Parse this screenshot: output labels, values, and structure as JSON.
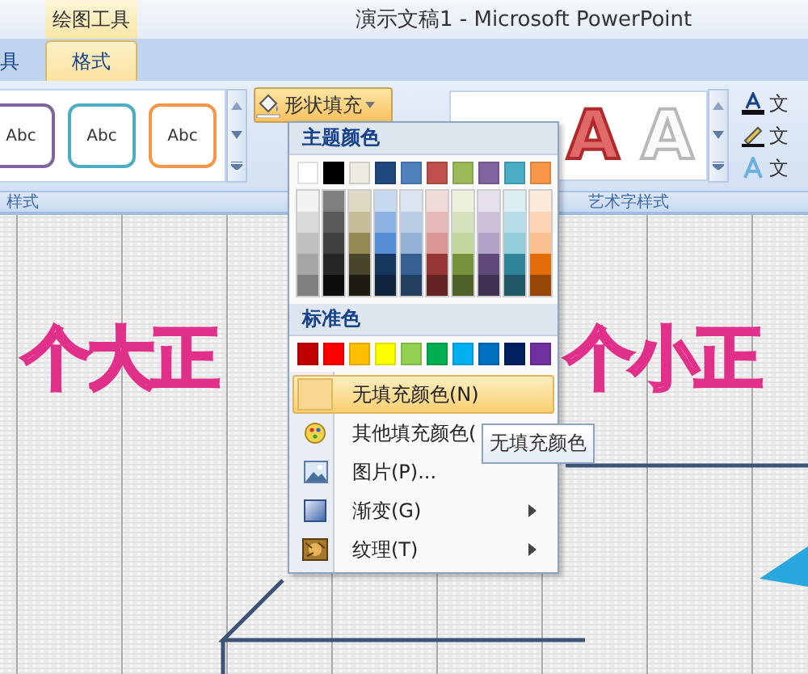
{
  "contextual_tab_group": "绘图工具",
  "window": {
    "title": "演示文稿1 - Microsoft PowerPoint"
  },
  "tabs": [
    {
      "label": "具",
      "selected": false
    },
    {
      "label": "格式",
      "selected": true
    }
  ],
  "shape_styles": {
    "group_label": "样式",
    "items": [
      {
        "label": "Abc",
        "color": "#8064a2"
      },
      {
        "label": "Abc",
        "color": "#4bacc6"
      },
      {
        "label": "Abc",
        "color": "#f79646"
      }
    ]
  },
  "shape_fill_button": {
    "label": "形状填充",
    "expanded": true
  },
  "wordart_styles": {
    "group_label": "艺术字样式",
    "items": [
      {
        "label": "A",
        "kind": "red-outline"
      },
      {
        "label": "A",
        "kind": "white-outline"
      }
    ]
  },
  "text_buttons": [
    {
      "label": "文",
      "kind": "fill"
    },
    {
      "label": "文",
      "kind": "outline"
    },
    {
      "label": "文",
      "kind": "effects"
    }
  ],
  "fill_menu": {
    "theme_heading": "主题颜色",
    "theme_colors": [
      {
        "color": "#ffffff",
        "shades": [
          {
            "color": "#f2f2f2"
          },
          {
            "color": "#d9d9d9"
          },
          {
            "color": "#bfbfbf"
          },
          {
            "color": "#a6a6a6"
          },
          {
            "color": "#808080"
          }
        ]
      },
      {
        "color": "#000000",
        "shades": [
          {
            "color": "#7f7f7f"
          },
          {
            "color": "#595959"
          },
          {
            "color": "#404040"
          },
          {
            "color": "#262626"
          },
          {
            "color": "#0d0d0d"
          }
        ]
      },
      {
        "color": "#eeece1",
        "shades": [
          {
            "color": "#ddd9c3"
          },
          {
            "color": "#c4bd97"
          },
          {
            "color": "#948a54"
          },
          {
            "color": "#4a452a"
          },
          {
            "color": "#1e1c11"
          }
        ]
      },
      {
        "color": "#1f497d",
        "shades": [
          {
            "color": "#c6d9f0"
          },
          {
            "color": "#8db3e2"
          },
          {
            "color": "#548dd4"
          },
          {
            "color": "#17365d"
          },
          {
            "color": "#0f243e"
          }
        ]
      },
      {
        "color": "#4f81bd",
        "shades": [
          {
            "color": "#dbe5f1"
          },
          {
            "color": "#b8cce4"
          },
          {
            "color": "#95b3d7"
          },
          {
            "color": "#366092"
          },
          {
            "color": "#244061"
          }
        ]
      },
      {
        "color": "#c0504d",
        "shades": [
          {
            "color": "#f2dcdb"
          },
          {
            "color": "#e5b9b7"
          },
          {
            "color": "#d99694"
          },
          {
            "color": "#953734"
          },
          {
            "color": "#632423"
          }
        ]
      },
      {
        "color": "#9bbb59",
        "shades": [
          {
            "color": "#ebf1dd"
          },
          {
            "color": "#d7e3bc"
          },
          {
            "color": "#c3d69b"
          },
          {
            "color": "#76923c"
          },
          {
            "color": "#4f6128"
          }
        ]
      },
      {
        "color": "#8064a2",
        "shades": [
          {
            "color": "#e5e0ec"
          },
          {
            "color": "#ccc1d9"
          },
          {
            "color": "#b2a2c7"
          },
          {
            "color": "#5f497a"
          },
          {
            "color": "#3f3151"
          }
        ]
      },
      {
        "color": "#4bacc6",
        "shades": [
          {
            "color": "#dbeef3"
          },
          {
            "color": "#b7dde8"
          },
          {
            "color": "#92cddc"
          },
          {
            "color": "#31859b"
          },
          {
            "color": "#205867"
          }
        ]
      },
      {
        "color": "#f79646",
        "shades": [
          {
            "color": "#fdeada"
          },
          {
            "color": "#fbd5b5"
          },
          {
            "color": "#fac08f"
          },
          {
            "color": "#e36c09"
          },
          {
            "color": "#974806"
          }
        ]
      }
    ],
    "standard_heading": "标准色",
    "standard_colors": [
      {
        "color": "#c00000"
      },
      {
        "color": "#ff0000"
      },
      {
        "color": "#ffc000"
      },
      {
        "color": "#ffff00"
      },
      {
        "color": "#92d050"
      },
      {
        "color": "#00b050"
      },
      {
        "color": "#00b0f0"
      },
      {
        "color": "#0070c0"
      },
      {
        "color": "#002060"
      },
      {
        "color": "#7030a0"
      }
    ],
    "items": [
      {
        "kind": "no-fill",
        "label": "无填充颜色(N)",
        "highlighted": true
      },
      {
        "kind": "more-colors",
        "label": "其他填充颜色(",
        "highlighted": false
      },
      {
        "kind": "picture",
        "label": "图片(P)...",
        "highlighted": false
      },
      {
        "kind": "gradient",
        "label": "渐变(G)",
        "highlighted": false
      },
      {
        "kind": "texture",
        "label": "纹理(T)",
        "highlighted": false
      }
    ]
  },
  "tooltip": "无填充颜色",
  "slide": {
    "wordart_left": "个大正",
    "wordart_right": "个小正"
  }
}
